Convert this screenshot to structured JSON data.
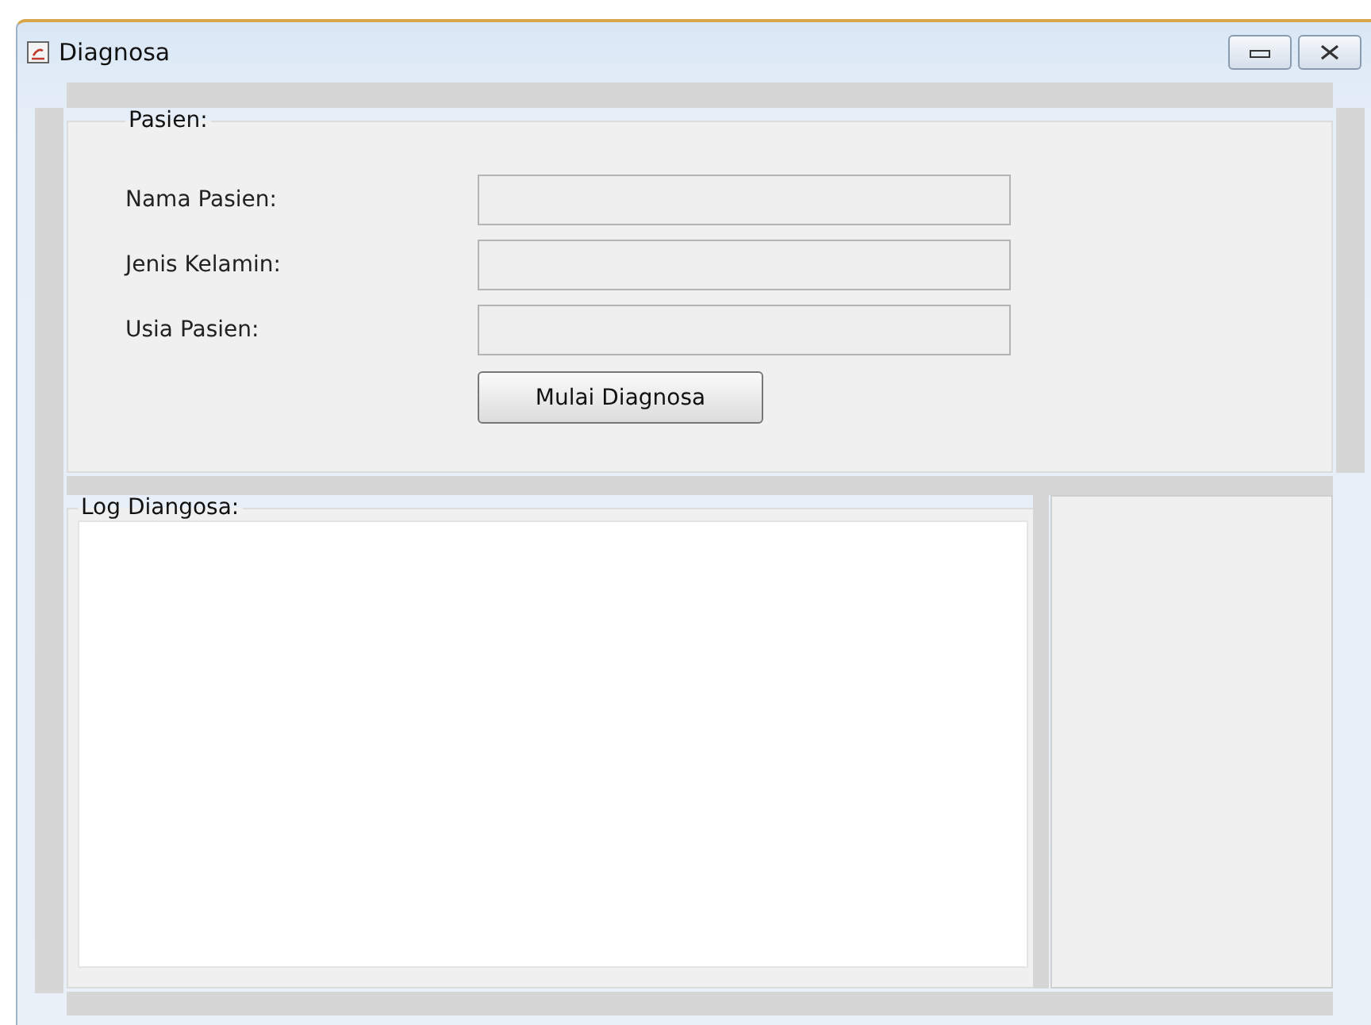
{
  "window": {
    "title": "Diagnosa"
  },
  "patient_panel": {
    "title": "Pasien:",
    "fields": [
      {
        "label": "Nama Pasien:"
      },
      {
        "label": "Jenis Kelamin:"
      },
      {
        "label": "Usia Pasien:"
      }
    ],
    "button": "Mulai Diagnosa"
  },
  "log_panel": {
    "title": "Log Diangosa:"
  }
}
